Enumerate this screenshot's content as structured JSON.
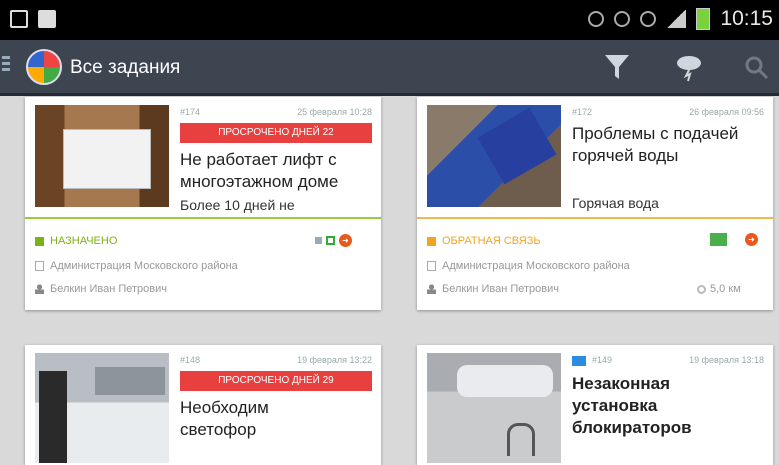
{
  "status_bar": {
    "time": "10:15"
  },
  "action_bar": {
    "title": "Все задания",
    "icons": [
      "filter-icon",
      "weather-icon",
      "search-icon"
    ]
  },
  "cards": [
    {
      "number": "#174",
      "date": "25 февраля 10:28",
      "overdue": "ПРОСРОЧЕНО ДНЕЙ 22",
      "title": "Не работает лифт с многоэтажном доме",
      "subtitle": "Более 10 дней не",
      "status": "НАЗНАЧЕНО",
      "status_color": "#7ab317",
      "org": "Администрация Московского района",
      "person": "Белкин Иван Петрович"
    },
    {
      "number": "#172",
      "date": "26 февраля 09:56",
      "title": "Проблемы с подачей горячей воды",
      "subtitle": "Горячая вода",
      "status": "ОБРАТНАЯ СВЯЗЬ",
      "status_color": "#f2a520",
      "org": "Администрация Московского района",
      "person": "Белкин Иван Петрович",
      "distance": "5,0 км"
    },
    {
      "number": "#148",
      "date": "19 февраля 13:22",
      "overdue": "ПРОСРОЧЕНО ДНЕЙ 29",
      "title": "Необходим светофор"
    },
    {
      "number": "#149",
      "date": "19 февраля 13:18",
      "title": "Незаконная установка блокираторов"
    }
  ]
}
